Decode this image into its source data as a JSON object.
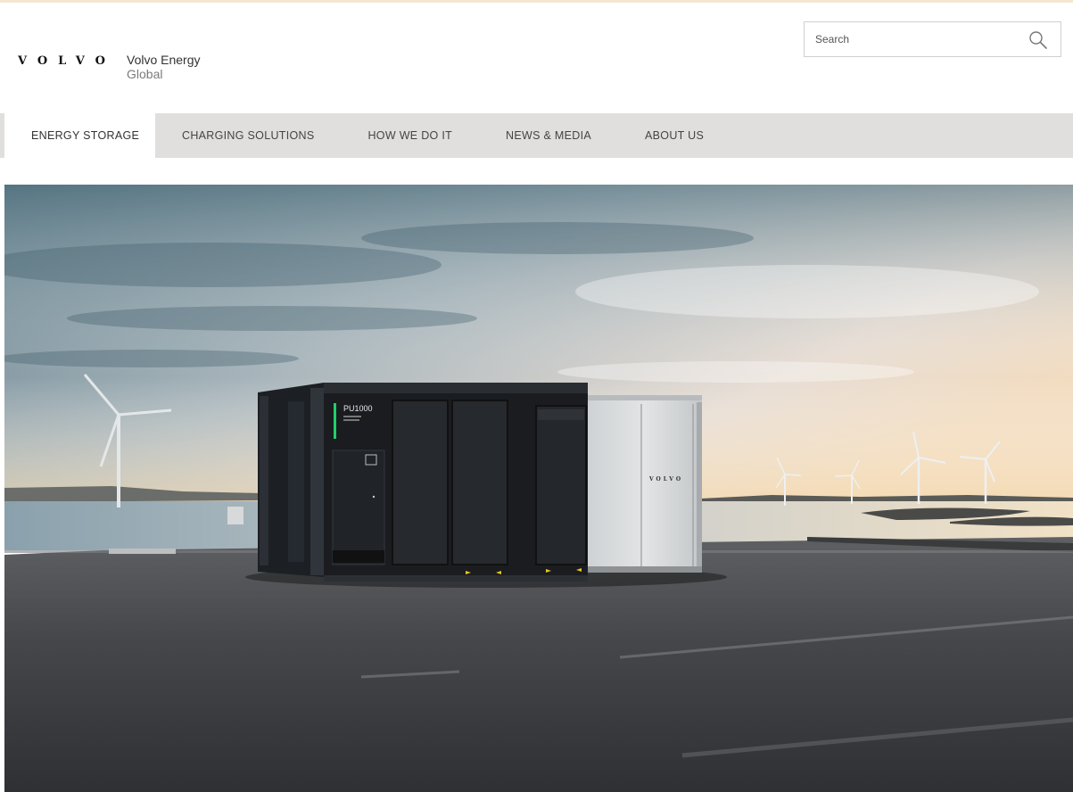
{
  "header": {
    "logo_text": "VOLVO",
    "brand_name": "Volvo Energy",
    "brand_sub": "Global"
  },
  "search": {
    "placeholder": "Search",
    "icon": "search-icon"
  },
  "nav": {
    "items": [
      {
        "label": "ENERGY STORAGE",
        "active": true
      },
      {
        "label": "CHARGING SOLUTIONS"
      },
      {
        "label": "HOW WE DO IT"
      },
      {
        "label": "NEWS & MEDIA"
      },
      {
        "label": "ABOUT US"
      }
    ]
  },
  "hero": {
    "container_label": "PU1000",
    "container_brand": "VOLVO"
  },
  "colors": {
    "accent_line": "#f3e7cf",
    "nav_bg": "#e0dfdd",
    "status_led": "#1fd16a"
  }
}
